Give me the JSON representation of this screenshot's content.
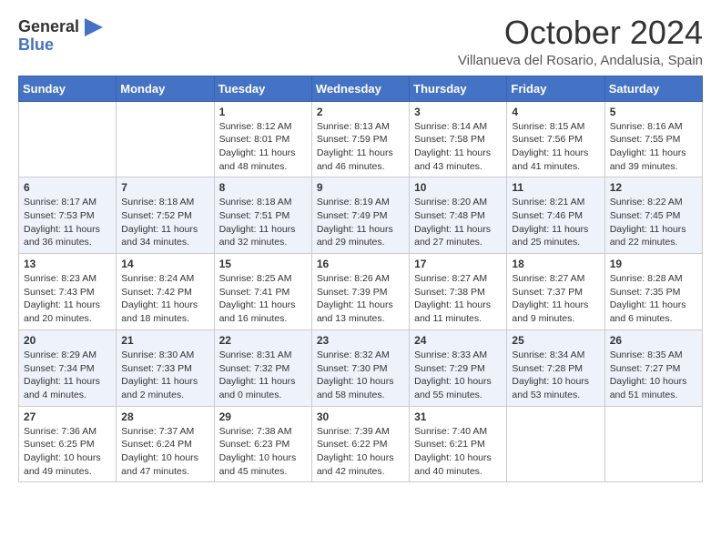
{
  "header": {
    "logo_general": "General",
    "logo_blue": "Blue",
    "month_title": "October 2024",
    "location": "Villanueva del Rosario, Andalusia, Spain"
  },
  "weekdays": [
    "Sunday",
    "Monday",
    "Tuesday",
    "Wednesday",
    "Thursday",
    "Friday",
    "Saturday"
  ],
  "weeks": [
    [
      {
        "day": "",
        "info": ""
      },
      {
        "day": "",
        "info": ""
      },
      {
        "day": "1",
        "info": "Sunrise: 8:12 AM\nSunset: 8:01 PM\nDaylight: 11 hours and 48 minutes."
      },
      {
        "day": "2",
        "info": "Sunrise: 8:13 AM\nSunset: 7:59 PM\nDaylight: 11 hours and 46 minutes."
      },
      {
        "day": "3",
        "info": "Sunrise: 8:14 AM\nSunset: 7:58 PM\nDaylight: 11 hours and 43 minutes."
      },
      {
        "day": "4",
        "info": "Sunrise: 8:15 AM\nSunset: 7:56 PM\nDaylight: 11 hours and 41 minutes."
      },
      {
        "day": "5",
        "info": "Sunrise: 8:16 AM\nSunset: 7:55 PM\nDaylight: 11 hours and 39 minutes."
      }
    ],
    [
      {
        "day": "6",
        "info": "Sunrise: 8:17 AM\nSunset: 7:53 PM\nDaylight: 11 hours and 36 minutes."
      },
      {
        "day": "7",
        "info": "Sunrise: 8:18 AM\nSunset: 7:52 PM\nDaylight: 11 hours and 34 minutes."
      },
      {
        "day": "8",
        "info": "Sunrise: 8:18 AM\nSunset: 7:51 PM\nDaylight: 11 hours and 32 minutes."
      },
      {
        "day": "9",
        "info": "Sunrise: 8:19 AM\nSunset: 7:49 PM\nDaylight: 11 hours and 29 minutes."
      },
      {
        "day": "10",
        "info": "Sunrise: 8:20 AM\nSunset: 7:48 PM\nDaylight: 11 hours and 27 minutes."
      },
      {
        "day": "11",
        "info": "Sunrise: 8:21 AM\nSunset: 7:46 PM\nDaylight: 11 hours and 25 minutes."
      },
      {
        "day": "12",
        "info": "Sunrise: 8:22 AM\nSunset: 7:45 PM\nDaylight: 11 hours and 22 minutes."
      }
    ],
    [
      {
        "day": "13",
        "info": "Sunrise: 8:23 AM\nSunset: 7:43 PM\nDaylight: 11 hours and 20 minutes."
      },
      {
        "day": "14",
        "info": "Sunrise: 8:24 AM\nSunset: 7:42 PM\nDaylight: 11 hours and 18 minutes."
      },
      {
        "day": "15",
        "info": "Sunrise: 8:25 AM\nSunset: 7:41 PM\nDaylight: 11 hours and 16 minutes."
      },
      {
        "day": "16",
        "info": "Sunrise: 8:26 AM\nSunset: 7:39 PM\nDaylight: 11 hours and 13 minutes."
      },
      {
        "day": "17",
        "info": "Sunrise: 8:27 AM\nSunset: 7:38 PM\nDaylight: 11 hours and 11 minutes."
      },
      {
        "day": "18",
        "info": "Sunrise: 8:27 AM\nSunset: 7:37 PM\nDaylight: 11 hours and 9 minutes."
      },
      {
        "day": "19",
        "info": "Sunrise: 8:28 AM\nSunset: 7:35 PM\nDaylight: 11 hours and 6 minutes."
      }
    ],
    [
      {
        "day": "20",
        "info": "Sunrise: 8:29 AM\nSunset: 7:34 PM\nDaylight: 11 hours and 4 minutes."
      },
      {
        "day": "21",
        "info": "Sunrise: 8:30 AM\nSunset: 7:33 PM\nDaylight: 11 hours and 2 minutes."
      },
      {
        "day": "22",
        "info": "Sunrise: 8:31 AM\nSunset: 7:32 PM\nDaylight: 11 hours and 0 minutes."
      },
      {
        "day": "23",
        "info": "Sunrise: 8:32 AM\nSunset: 7:30 PM\nDaylight: 10 hours and 58 minutes."
      },
      {
        "day": "24",
        "info": "Sunrise: 8:33 AM\nSunset: 7:29 PM\nDaylight: 10 hours and 55 minutes."
      },
      {
        "day": "25",
        "info": "Sunrise: 8:34 AM\nSunset: 7:28 PM\nDaylight: 10 hours and 53 minutes."
      },
      {
        "day": "26",
        "info": "Sunrise: 8:35 AM\nSunset: 7:27 PM\nDaylight: 10 hours and 51 minutes."
      }
    ],
    [
      {
        "day": "27",
        "info": "Sunrise: 7:36 AM\nSunset: 6:25 PM\nDaylight: 10 hours and 49 minutes."
      },
      {
        "day": "28",
        "info": "Sunrise: 7:37 AM\nSunset: 6:24 PM\nDaylight: 10 hours and 47 minutes."
      },
      {
        "day": "29",
        "info": "Sunrise: 7:38 AM\nSunset: 6:23 PM\nDaylight: 10 hours and 45 minutes."
      },
      {
        "day": "30",
        "info": "Sunrise: 7:39 AM\nSunset: 6:22 PM\nDaylight: 10 hours and 42 minutes."
      },
      {
        "day": "31",
        "info": "Sunrise: 7:40 AM\nSunset: 6:21 PM\nDaylight: 10 hours and 40 minutes."
      },
      {
        "day": "",
        "info": ""
      },
      {
        "day": "",
        "info": ""
      }
    ]
  ]
}
